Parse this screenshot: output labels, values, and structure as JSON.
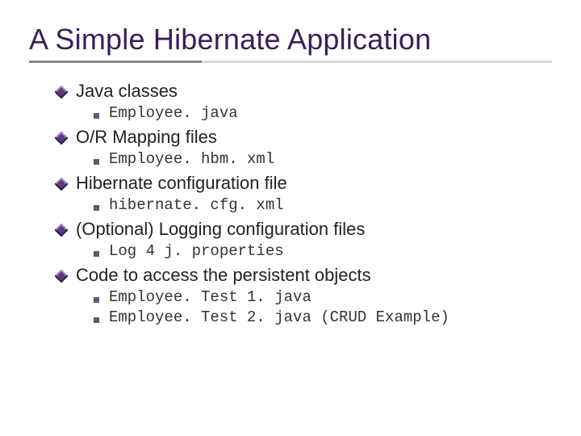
{
  "title": "A Simple Hibernate Application",
  "sections": [
    {
      "label": "Java classes",
      "items": [
        "Employee. java"
      ]
    },
    {
      "label": "O/R Mapping files",
      "items": [
        "Employee. hbm. xml"
      ]
    },
    {
      "label": "Hibernate configuration file",
      "items": [
        "hibernate. cfg. xml"
      ]
    },
    {
      "label": "(Optional) Logging configuration files",
      "items": [
        "Log 4 j. properties"
      ]
    },
    {
      "label": "Code to access the persistent objects",
      "items": [
        "Employee. Test 1. java",
        "Employee. Test 2. java  (CRUD Example)"
      ]
    }
  ]
}
